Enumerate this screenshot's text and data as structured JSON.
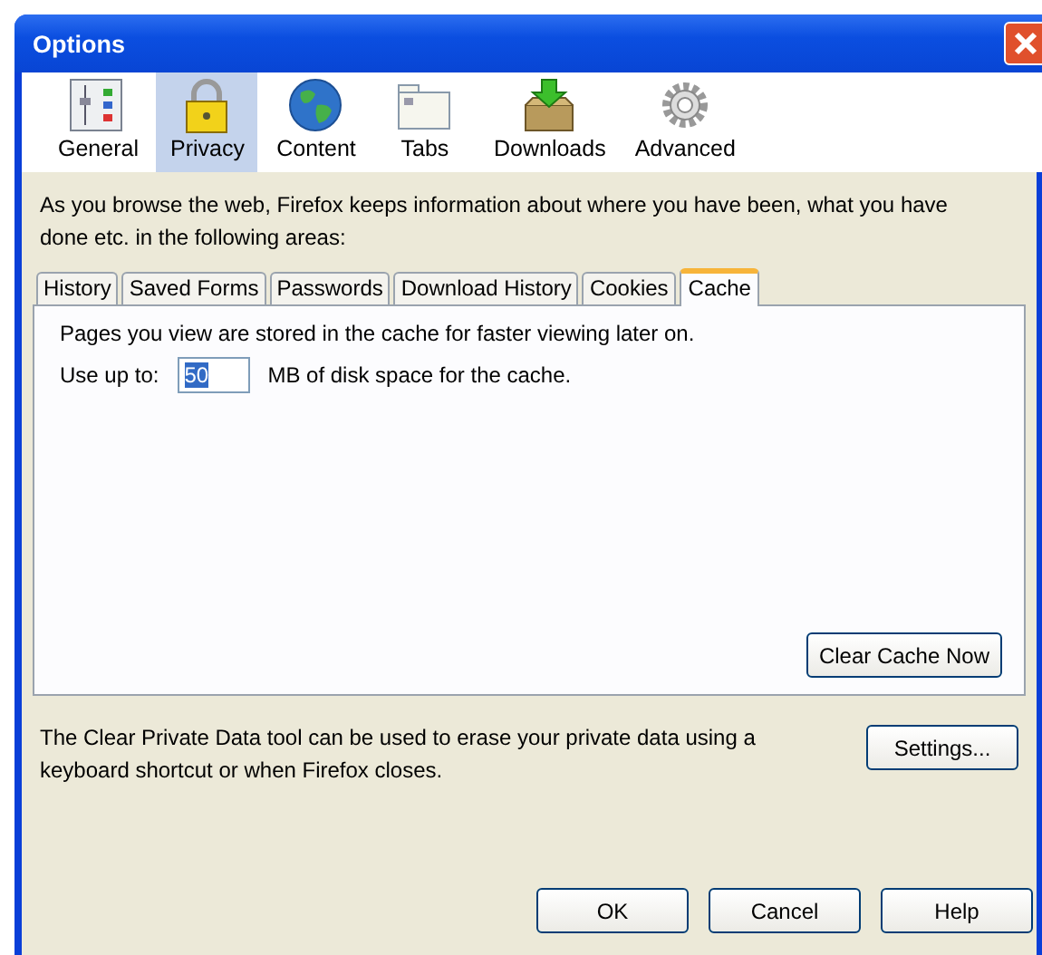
{
  "window": {
    "title": "Options"
  },
  "toolbar": [
    {
      "label": "General",
      "selected": false
    },
    {
      "label": "Privacy",
      "selected": true
    },
    {
      "label": "Content",
      "selected": false
    },
    {
      "label": "Tabs",
      "selected": false
    },
    {
      "label": "Downloads",
      "selected": false
    },
    {
      "label": "Advanced",
      "selected": false
    }
  ],
  "intro": "As you browse the web, Firefox keeps information about where you have been, what you have done etc. in the following areas:",
  "tabs": [
    {
      "label": "History",
      "selected": false
    },
    {
      "label": "Saved Forms",
      "selected": false
    },
    {
      "label": "Passwords",
      "selected": false
    },
    {
      "label": "Download History",
      "selected": false
    },
    {
      "label": "Cookies",
      "selected": false
    },
    {
      "label": "Cache",
      "selected": true
    }
  ],
  "cache": {
    "description": "Pages you view are stored in the cache for faster viewing later on.",
    "use_up_to_label": "Use up to:",
    "size_field": {
      "value": "50",
      "text_selected": true
    },
    "size_suffix": "MB of disk space for the cache.",
    "clear_button": "Clear Cache Now"
  },
  "clear_private_data": {
    "text": "The Clear Private Data tool can be used to erase your private data using a keyboard shortcut or when Firefox closes.",
    "settings_button": "Settings..."
  },
  "buttons": [
    "OK",
    "Cancel",
    "Help"
  ]
}
